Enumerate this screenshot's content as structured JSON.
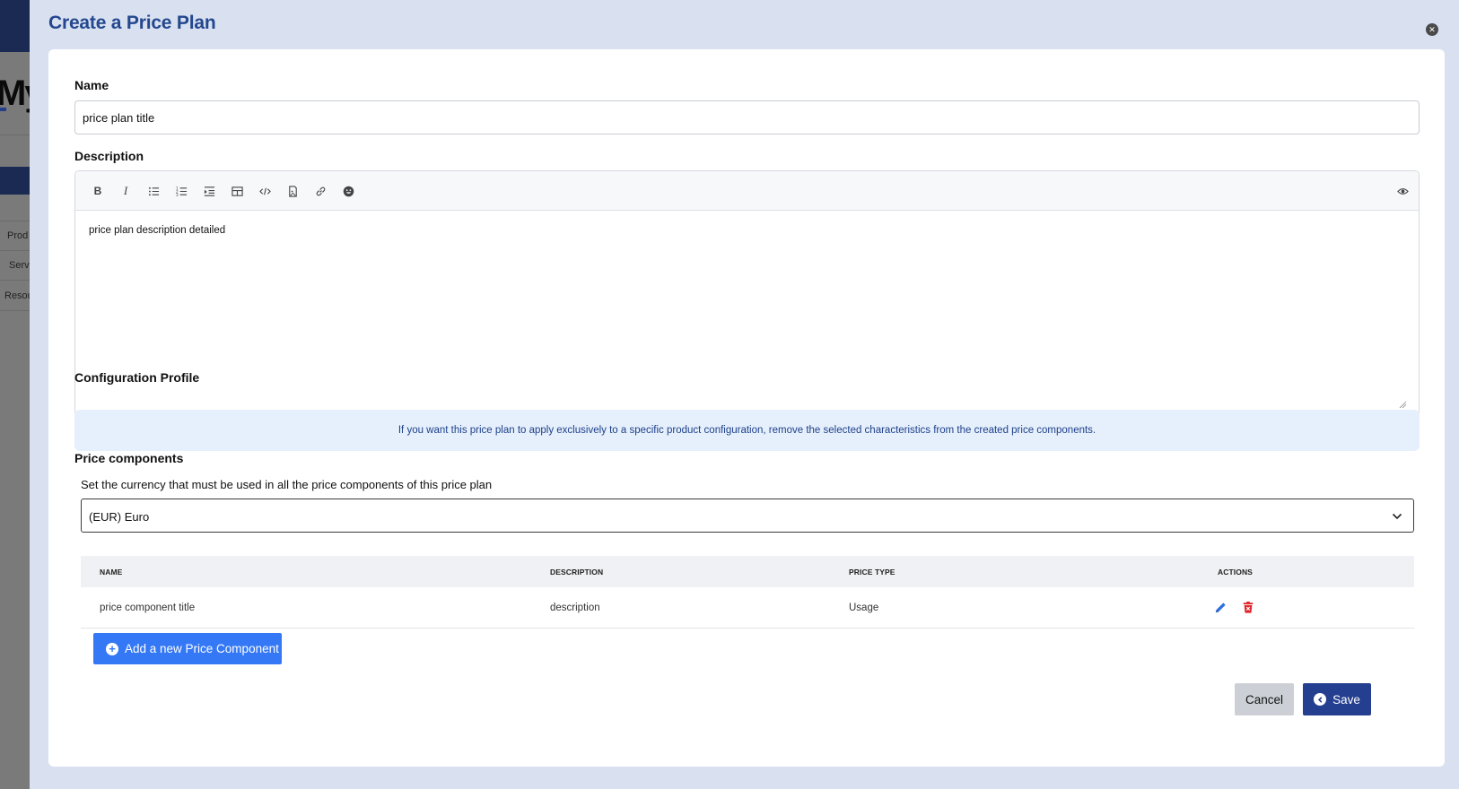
{
  "background": {
    "logo_text": "My",
    "nav_items": [
      "Prod",
      "Serv",
      "Resou"
    ]
  },
  "modal": {
    "title": "Create a Price Plan",
    "close_icon": "close-icon"
  },
  "form": {
    "name": {
      "label": "Name",
      "value": "price plan title"
    },
    "description": {
      "label": "Description",
      "toolbar": [
        "bold-icon",
        "italic-icon",
        "bulleted-list-icon",
        "numbered-list-icon",
        "indent-icon",
        "table-icon",
        "code-icon",
        "image-icon",
        "link-icon",
        "emoji-icon",
        "preview-eye-icon"
      ],
      "value": "price plan description detailed"
    },
    "configuration_profile": {
      "label": "Configuration Profile",
      "info": "If you want this price plan to apply exclusively to a specific product configuration, remove the selected characteristics from the created price components."
    },
    "price_components": {
      "label": "Price components",
      "currency_helper": "Set the currency that must be used in all the price components of this price plan",
      "currency_value": "(EUR) Euro",
      "table": {
        "headers": [
          "NAME",
          "DESCRIPTION",
          "PRICE TYPE",
          "ACTIONS"
        ],
        "rows": [
          {
            "name": "price component title",
            "description": "description",
            "price_type": "Usage"
          }
        ]
      },
      "add_button": "Add a new Price Component"
    }
  },
  "footer": {
    "cancel": "Cancel",
    "save": "Save"
  },
  "colors": {
    "modal_bg": "#d9e1f1",
    "title": "#24478e",
    "primary": "#3478f6",
    "save": "#243f8f",
    "delete": "#e0262b",
    "info_bg": "#e6f0fc"
  }
}
